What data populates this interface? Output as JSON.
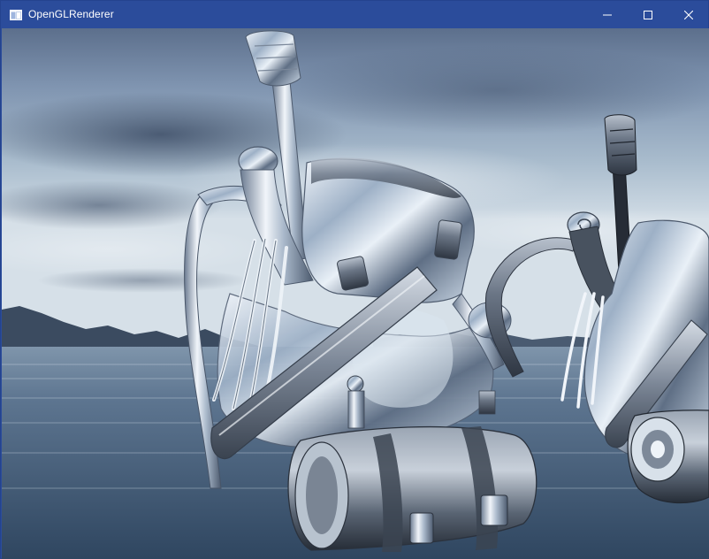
{
  "window": {
    "title": "OpenGLRenderer",
    "controls": {
      "minimize_icon": "minimize-icon",
      "maximize_icon": "maximize-icon",
      "close_icon": "close-icon"
    }
  },
  "colors": {
    "titlebar": "#2b4c9b",
    "title_text": "#ffffff",
    "sky_top": "#4a5e7d",
    "sky_horizon": "#c9d6e1",
    "water": "#33485f",
    "metal_light": "#e6eef6",
    "metal_dark": "#3c4656"
  }
}
